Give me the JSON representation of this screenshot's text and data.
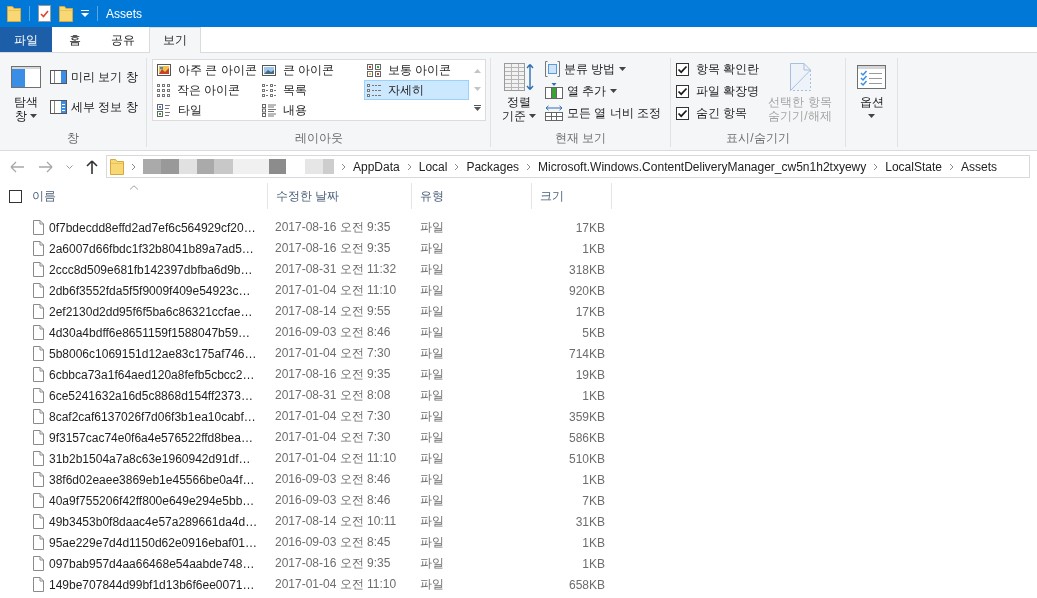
{
  "title_bar": {
    "title": "Assets"
  },
  "ribbon": {
    "tabs": [
      {
        "label": "파일",
        "kind": "file",
        "selected": false
      },
      {
        "label": "홈",
        "kind": "tab",
        "selected": false
      },
      {
        "label": "공유",
        "kind": "tab",
        "selected": false
      },
      {
        "label": "보기",
        "kind": "tab",
        "selected": true
      }
    ],
    "panes": {
      "label": "창",
      "navigation_pane": {
        "lines": [
          "탐색",
          "창"
        ],
        "dropdown": true
      },
      "buttons": [
        {
          "label": "미리 보기 창",
          "kind": "preview-pane"
        },
        {
          "label": "세부 정보 창",
          "kind": "details-pane"
        }
      ]
    },
    "layout": {
      "label": "레이아웃",
      "items": [
        {
          "label": "아주 큰 아이콘",
          "kind": "extra-large-icons",
          "selected": false
        },
        {
          "label": "큰 아이콘",
          "kind": "large-icons",
          "selected": false
        },
        {
          "label": "보통 아이콘",
          "kind": "medium-icons",
          "selected": false
        },
        {
          "label": "작은 아이콘",
          "kind": "small-icons",
          "selected": false
        },
        {
          "label": "목록",
          "kind": "list",
          "selected": false
        },
        {
          "label": "자세히",
          "kind": "details",
          "selected": true
        },
        {
          "label": "타일",
          "kind": "tiles",
          "selected": false
        },
        {
          "label": "내용",
          "kind": "content",
          "selected": false
        }
      ]
    },
    "current_view": {
      "label": "현재 보기",
      "sort_by": {
        "lines": [
          "정렬",
          "기준"
        ],
        "dropdown": true
      },
      "buttons": [
        {
          "label": "분류 방법",
          "kind": "group-by",
          "dropdown": true
        },
        {
          "label": "열 추가",
          "kind": "add-columns",
          "dropdown": true
        },
        {
          "label": "모든 열 너비 조정",
          "kind": "size-columns",
          "dropdown": false
        }
      ]
    },
    "show_hide": {
      "label": "표시/숨기기",
      "checkboxes": [
        {
          "label": "항목 확인란",
          "checked": true
        },
        {
          "label": "파일 확장명",
          "checked": true
        },
        {
          "label": "숨긴 항목",
          "checked": true
        }
      ],
      "hide_selected": {
        "lines": [
          "선택한 항목",
          "숨기기/해제"
        ],
        "disabled": true
      }
    },
    "options": {
      "lines": [
        "옵션"
      ],
      "dropdown": true
    }
  },
  "address_bar": {
    "back": {
      "disabled": true
    },
    "forward": {
      "disabled": true
    },
    "up": {
      "disabled": false
    },
    "path": [
      "AppData",
      "Local",
      "Packages",
      "Microsoft.Windows.ContentDeliveryManager_cw5n1h2txyewy",
      "LocalState",
      "Assets"
    ]
  },
  "file_list": {
    "select_all": {
      "checked": false
    },
    "columns": [
      {
        "label": "이름",
        "sorted": true
      },
      {
        "label": "수정한 날짜",
        "sorted": false
      },
      {
        "label": "유형",
        "sorted": false
      },
      {
        "label": "크기",
        "sorted": false
      }
    ],
    "rows": [
      {
        "name": "0f7bdecdd8effd2ad7ef6c564929cf20…",
        "modified": "2017-08-16 오전 9:35",
        "type": "파일",
        "size": "17KB"
      },
      {
        "name": "2a6007d66fbdc1f32b8041b89a7ad5…",
        "modified": "2017-08-16 오전 9:35",
        "type": "파일",
        "size": "1KB"
      },
      {
        "name": "2ccc8d509e681fb142397dbfba6d9b…",
        "modified": "2017-08-31 오전 11:32",
        "type": "파일",
        "size": "318KB"
      },
      {
        "name": "2db6f3552fda5f5f9009f409e54923c…",
        "modified": "2017-01-04 오전 11:10",
        "type": "파일",
        "size": "920KB"
      },
      {
        "name": "2ef2130d2dd95f6f5ba6c86321ccfae…",
        "modified": "2017-08-14 오전 9:55",
        "type": "파일",
        "size": "17KB"
      },
      {
        "name": "4d30a4bdff6e8651159f1588047b59…",
        "modified": "2016-09-03 오전 8:46",
        "type": "파일",
        "size": "5KB"
      },
      {
        "name": "5b8006c1069151d12ae83c175af746…",
        "modified": "2017-01-04 오전 7:30",
        "type": "파일",
        "size": "714KB"
      },
      {
        "name": "6cbbca73a1f64aed120a8fefb5cbcc2…",
        "modified": "2017-08-16 오전 9:35",
        "type": "파일",
        "size": "19KB"
      },
      {
        "name": "6ce5241632a16d5c8868d154ff2373…",
        "modified": "2017-08-31 오전 8:08",
        "type": "파일",
        "size": "1KB"
      },
      {
        "name": "8caf2caf6137026f7d06f3b1ea10cabf…",
        "modified": "2017-01-04 오전 7:30",
        "type": "파일",
        "size": "359KB"
      },
      {
        "name": "9f3157cac74e0f6a4e576522ffd8bea…",
        "modified": "2017-01-04 오전 7:30",
        "type": "파일",
        "size": "586KB"
      },
      {
        "name": "31b2b1504a7a8c63e1960942d91df…",
        "modified": "2017-01-04 오전 11:10",
        "type": "파일",
        "size": "510KB"
      },
      {
        "name": "38f6d02eaee3869eb1e45566be0a4f…",
        "modified": "2016-09-03 오전 8:46",
        "type": "파일",
        "size": "1KB"
      },
      {
        "name": "40a9f755206f42ff800e649e294e5bb…",
        "modified": "2016-09-03 오전 8:46",
        "type": "파일",
        "size": "7KB"
      },
      {
        "name": "49b3453b0f8daac4e57a289661da4d…",
        "modified": "2017-08-14 오전 10:11",
        "type": "파일",
        "size": "31KB"
      },
      {
        "name": "95ae229e7d4d1150d62e0916ebaf01…",
        "modified": "2016-09-03 오전 8:45",
        "type": "파일",
        "size": "1KB"
      },
      {
        "name": "097bab957d4aa66468e54aabde748…",
        "modified": "2017-08-16 오전 9:35",
        "type": "파일",
        "size": "1KB"
      },
      {
        "name": "149be707844d99bf1d13b6f6ee0071…",
        "modified": "2017-01-04 오전 11:10",
        "type": "파일",
        "size": "658KB"
      }
    ]
  }
}
